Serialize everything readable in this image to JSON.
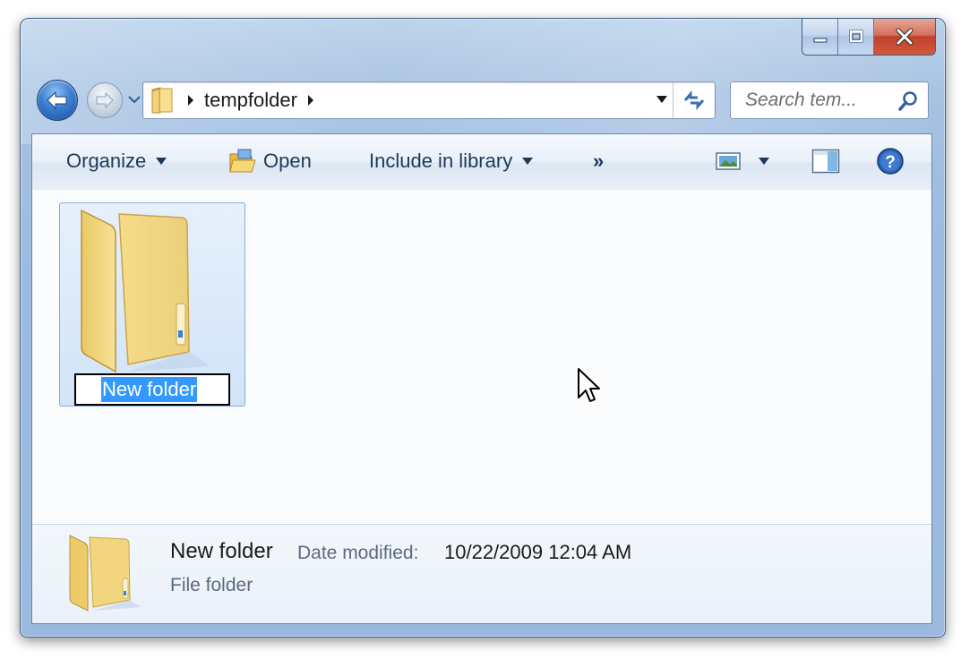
{
  "window": {
    "caption": {
      "minimize_icon": "minimize-icon",
      "maximize_icon": "maximize-icon",
      "close_icon": "close-icon",
      "close_color": "#c9452e"
    }
  },
  "nav": {
    "back_icon": "arrow-left-icon",
    "forward_icon": "arrow-right-icon",
    "breadcrumb": [
      "tempfolder"
    ],
    "search_placeholder": "Search tem..."
  },
  "toolbar": {
    "organize_label": "Organize",
    "open_label": "Open",
    "include_label": "Include in library",
    "more_label": "»"
  },
  "content": {
    "items": [
      {
        "name": "New folder",
        "renaming": true,
        "icon": "folder-icon"
      }
    ]
  },
  "details": {
    "name": "New folder",
    "date_label": "Date modified:",
    "date_value": "10/22/2009 12:04 AM",
    "type": "File folder"
  },
  "colors": {
    "accent": "#3399ff",
    "frame": "#9cbbe0",
    "toolbar_text": "#1e395b"
  }
}
